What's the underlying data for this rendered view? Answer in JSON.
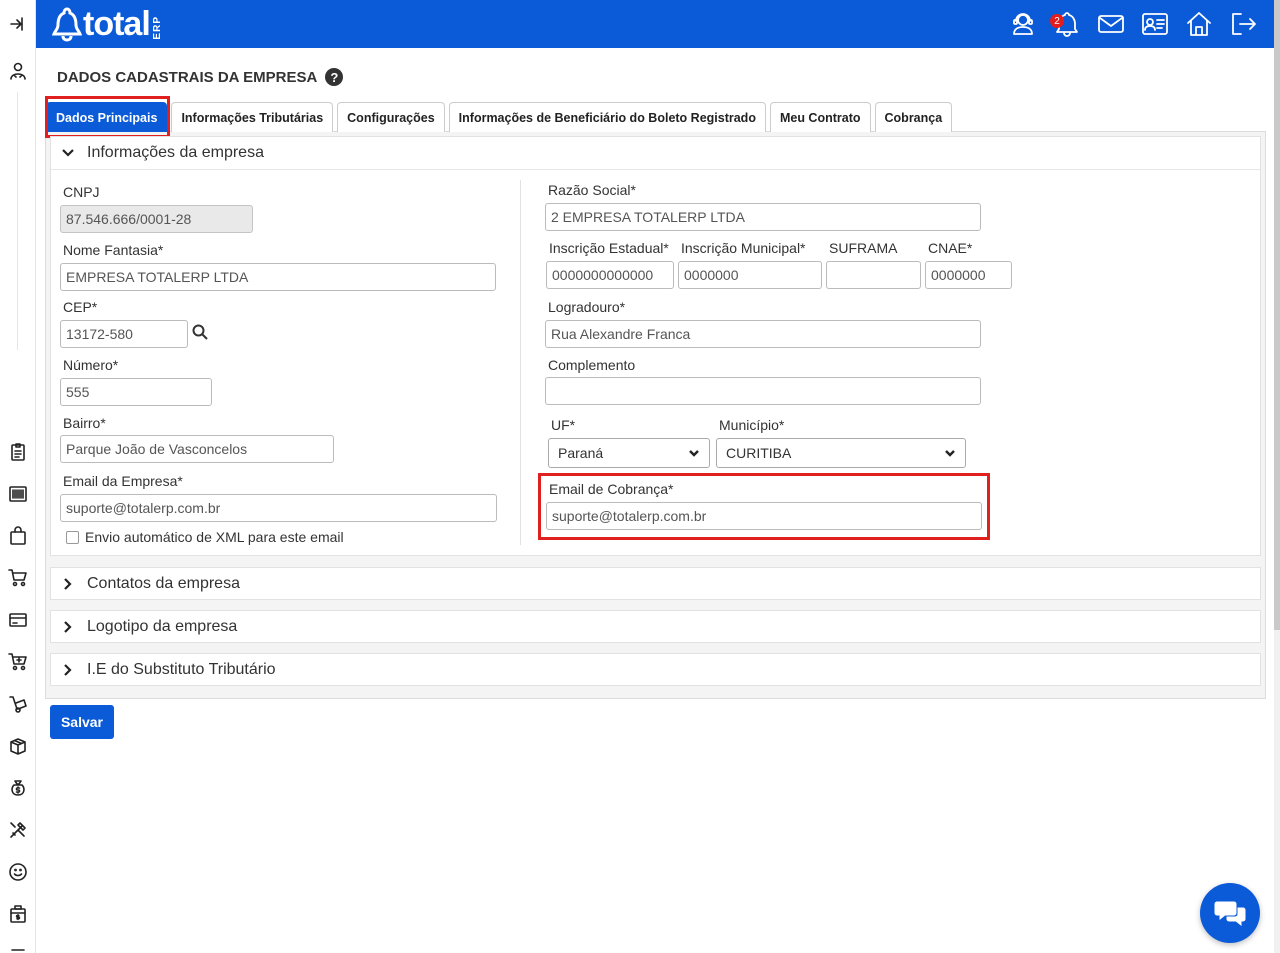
{
  "brand": {
    "logo_text": "total",
    "logo_suffix": "ERP",
    "color": "#0b5bd9"
  },
  "header": {
    "notification_count": "2",
    "icons": [
      "support-agent-icon",
      "bell-icon",
      "mail-icon",
      "contact-card-icon",
      "home-icon",
      "logout-icon"
    ]
  },
  "sidebar": {
    "icons": [
      "pin-icon",
      "users-icon",
      "clipboard-icon",
      "barcode-icon",
      "shopping-bag-icon",
      "cart-icon",
      "credit-card-icon",
      "cart-add-icon",
      "hand-truck-icon",
      "box-icon",
      "money-bag-icon",
      "tools-icon",
      "smiley-icon",
      "cash-register-icon"
    ]
  },
  "page": {
    "title": "DADOS CADASTRAIS DA EMPRESA"
  },
  "tabs": [
    {
      "label": "Dados Principais"
    },
    {
      "label": "Informações Tributárias"
    },
    {
      "label": "Configurações"
    },
    {
      "label": "Informações de Beneficiário do Boleto Registrado"
    },
    {
      "label": "Meu Contrato"
    },
    {
      "label": "Cobrança"
    }
  ],
  "sections": {
    "info_empresa": "Informações da empresa",
    "contatos": "Contatos da empresa",
    "logotipo": "Logotipo da empresa",
    "ie_substituto": "I.E do Substituto Tributário"
  },
  "form": {
    "cnpj": {
      "label": "CNPJ",
      "value": "87.546.666/0001-28"
    },
    "nome_fantasia": {
      "label": "Nome Fantasia*",
      "value": "EMPRESA TOTALERP LTDA"
    },
    "cep": {
      "label": "CEP*",
      "value": "13172-580"
    },
    "numero": {
      "label": "Número*",
      "value": "555"
    },
    "bairro": {
      "label": "Bairro*",
      "value": "Parque João de Vasconcelos"
    },
    "email_empresa": {
      "label": "Email da Empresa*",
      "value": "suporte@totalerp.com.br"
    },
    "envio_xml": {
      "label": "Envio automático de XML para este email"
    },
    "razao_social": {
      "label": "Razão Social*",
      "value": "2 EMPRESA TOTALERP LTDA"
    },
    "inscricao_estadual": {
      "label": "Inscrição Estadual*",
      "value": "0000000000000"
    },
    "inscricao_municipal": {
      "label": "Inscrição Municipal*",
      "value": "0000000"
    },
    "suframa": {
      "label": "SUFRAMA",
      "value": ""
    },
    "cnae": {
      "label": "CNAE*",
      "value": "0000000"
    },
    "logradouro": {
      "label": "Logradouro*",
      "value": "Rua Alexandre Franca"
    },
    "complemento": {
      "label": "Complemento",
      "value": ""
    },
    "uf": {
      "label": "UF*",
      "value": "Paraná"
    },
    "municipio": {
      "label": "Município*",
      "value": "CURITIBA"
    },
    "email_cobranca": {
      "label": "Email de Cobrança*",
      "value": "suporte@totalerp.com.br"
    }
  },
  "actions": {
    "save_label": "Salvar"
  },
  "colors": {
    "highlight": "#e0201e",
    "primary": "#0b5bd9"
  }
}
